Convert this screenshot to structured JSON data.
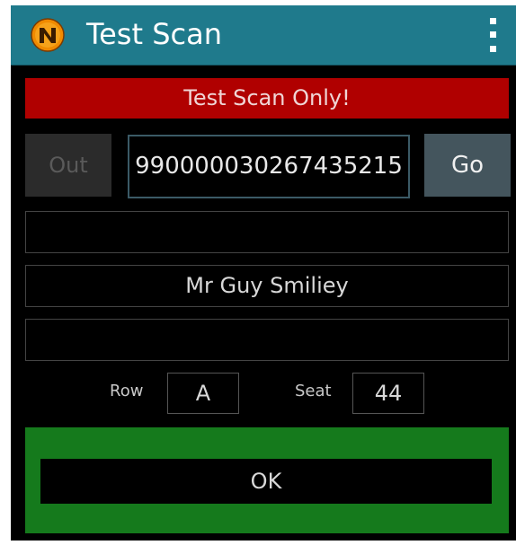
{
  "app": {
    "title": "Test Scan",
    "logo_icon": "n-logo-icon",
    "menu_icon": "overflow-menu-icon"
  },
  "banner": {
    "text": "Test Scan Only!",
    "color": "#b00000"
  },
  "scan": {
    "out_label": "Out",
    "code_value": "990000030267435215",
    "go_label": "Go"
  },
  "fields": {
    "line1": "",
    "name": "Mr Guy Smiliey",
    "line3": ""
  },
  "seat": {
    "row_label": "Row",
    "row_value": "A",
    "seat_label": "Seat",
    "seat_value": "44"
  },
  "ok": {
    "label": "OK",
    "panel_color": "#157a1c"
  },
  "colors": {
    "appbar": "#1f7a8c",
    "background": "#000000"
  }
}
